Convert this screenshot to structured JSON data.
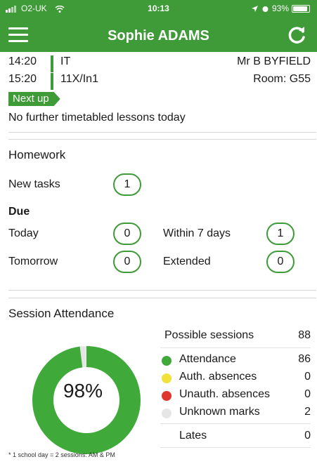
{
  "status_bar": {
    "carrier": "O2-UK",
    "time": "10:13",
    "battery": "93%",
    "battery_level": 0.93
  },
  "header": {
    "title": "Sophie ADAMS",
    "menu_icon": "hamburger-menu-icon",
    "refresh_icon": "refresh-icon"
  },
  "lessons": [
    {
      "time": "14:20",
      "subject": "IT",
      "right": "Mr B BYFIELD"
    },
    {
      "time": "15:20",
      "subject": "11X/In1",
      "right": "Room: G55"
    }
  ],
  "next_up": {
    "badge": "Next up",
    "text": "No further timetabled lessons today"
  },
  "homework": {
    "title": "Homework",
    "new_tasks_label": "New tasks",
    "new_tasks_count": "1",
    "due_label": "Due",
    "today_label": "Today",
    "today_count": "0",
    "within7_label": "Within 7 days",
    "within7_count": "1",
    "tomorrow_label": "Tomorrow",
    "tomorrow_count": "0",
    "extended_label": "Extended",
    "extended_count": "0"
  },
  "attendance": {
    "title": "Session Attendance",
    "percent_label": "98%",
    "percent_value": 98,
    "possible_label": "Possible sessions",
    "possible_value": "88",
    "rows": [
      {
        "label": "Attendance",
        "value": "86",
        "color": "#3fa93a"
      },
      {
        "label": "Auth. absences",
        "value": "0",
        "color": "#f1e23a"
      },
      {
        "label": "Unauth. absences",
        "value": "0",
        "color": "#e0362f"
      },
      {
        "label": "Unknown marks",
        "value": "2",
        "color": "#e6e6e6"
      }
    ],
    "lates_label": "Lates",
    "lates_value": "0"
  },
  "colors": {
    "brand_green": "#3f9a38",
    "donut_green": "#3fa93a",
    "donut_grey": "#e6e6e6"
  },
  "footnote": "* 1 school day = 2 sessions: AM & PM"
}
